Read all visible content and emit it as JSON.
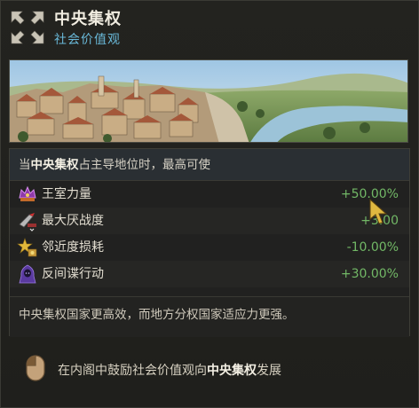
{
  "header": {
    "title": "中央集权",
    "subtitle": "社会价值观"
  },
  "effects": {
    "intro_prefix": "当",
    "intro_emphasis": "中央集权",
    "intro_suffix": "占主导地位时，最高可使",
    "rows": [
      {
        "icon": "crown-fist-icon",
        "label": "王室力量",
        "value": "+50.00%"
      },
      {
        "icon": "war-weariness-icon",
        "label": "最大厌战度",
        "value": "+3.00"
      },
      {
        "icon": "star-coins-icon",
        "label": "邻近度损耗",
        "value": "-10.00%"
      },
      {
        "icon": "hooded-spy-icon",
        "label": "反间谍行动",
        "value": "+30.00%"
      }
    ],
    "description": "中央集权国家更高效，而地方分权国家适应力更强。"
  },
  "footer": {
    "icon": "mouse-icon",
    "text_prefix": "在内阁中鼓励社会价值观向",
    "text_emphasis": "中央集权",
    "text_suffix": "发展"
  },
  "colors": {
    "subtitle": "#69b8d8",
    "value": "#72b866",
    "header_bg": "#2a2f33"
  }
}
